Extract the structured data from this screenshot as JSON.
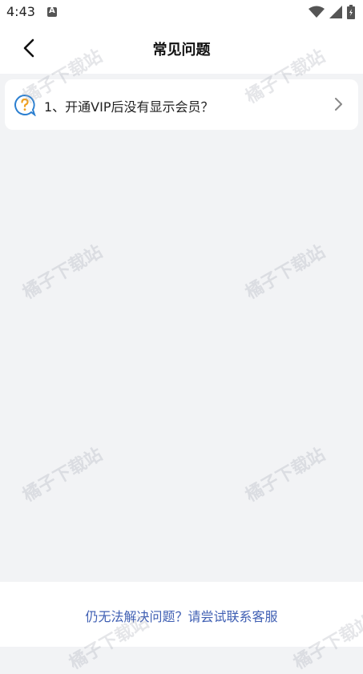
{
  "status_bar": {
    "time": "4:43",
    "icons": [
      "a-notification-icon",
      "wifi-icon",
      "signal-icon",
      "battery-icon"
    ]
  },
  "header": {
    "title": "常见问题",
    "back_icon": "chevron-left-icon"
  },
  "faq": {
    "items": [
      {
        "label": "1、开通VIP后没有显示会员？",
        "icon": "question-bubble-icon"
      }
    ]
  },
  "footer": {
    "contact_label": "仍无法解决问题？请尝试联系客服"
  },
  "watermark": {
    "text": "橘子下载站"
  },
  "colors": {
    "background": "#f2f3f5",
    "card": "#ffffff",
    "link": "#3f5fb3",
    "icon_blue": "#2b7fd0",
    "icon_orange": "#f0a020"
  }
}
